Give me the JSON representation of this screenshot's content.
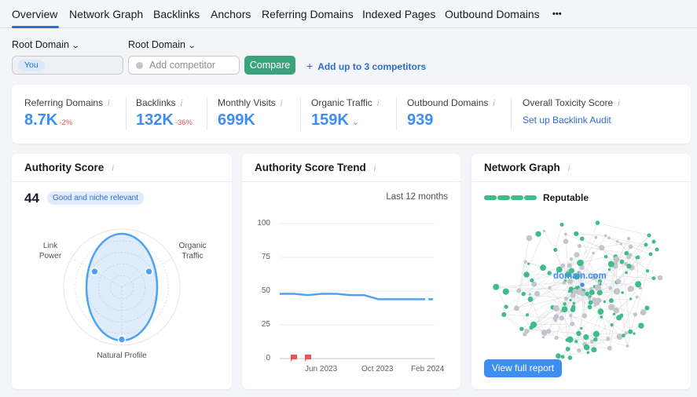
{
  "tabs": [
    {
      "label": "Overview",
      "active": true
    },
    {
      "label": "Network Graph"
    },
    {
      "label": "Backlinks"
    },
    {
      "label": "Anchors"
    },
    {
      "label": "Referring Domains"
    },
    {
      "label": "Indexed Pages"
    },
    {
      "label": "Outbound Domains"
    },
    {
      "label": "•••"
    }
  ],
  "filters": {
    "scope1": "Root Domain",
    "scope2": "Root Domain",
    "you_label": "You",
    "competitor_placeholder": "Add competitor",
    "compare_button": "Compare",
    "add_competitors_link": "Add up to 3 competitors"
  },
  "metrics": [
    {
      "label": "Referring Domains",
      "value": "8.7K",
      "delta": "-2%"
    },
    {
      "label": "Backlinks",
      "value": "132K",
      "delta": "-36%"
    },
    {
      "label": "Monthly Visits",
      "value": "699K"
    },
    {
      "label": "Organic Traffic",
      "value": "159K"
    },
    {
      "label": "Outbound Domains",
      "value": "939"
    },
    {
      "label": "Overall Toxicity Score",
      "link": "Set up Backlink Audit"
    }
  ],
  "authority": {
    "title": "Authority Score",
    "score": "44",
    "badge": "Good and niche relevant",
    "axes": {
      "link_power": "Link\nPower",
      "organic_traffic": "Organic\nTraffic",
      "natural_profile": "Natural Profile"
    },
    "radar_values": {
      "link_power": 0.7,
      "organic_traffic": 0.7,
      "natural_profile": 1.0
    }
  },
  "trend": {
    "title": "Authority Score Trend",
    "period": "Last 12 months",
    "yticks": [
      "100",
      "75",
      "50",
      "25",
      "0"
    ],
    "xticks": [
      "Jun 2023",
      "Oct 2023",
      "Feb 2024"
    ]
  },
  "network": {
    "title": "Network Graph",
    "status": "Reputable",
    "status_level": 4,
    "center_label": "domain.com",
    "button": "View full report"
  },
  "colors": {
    "accent": "#3d8ef0",
    "link": "#2c6ecb",
    "positive": "#3ebc8a",
    "negative": "#e8545a",
    "compare": "#3aa27c"
  },
  "chart_data": [
    {
      "type": "line",
      "title": "Authority Score Trend",
      "xlabel": "",
      "ylabel": "",
      "ylim": [
        0,
        100
      ],
      "yticks": [
        0,
        25,
        50,
        75,
        100
      ],
      "x_tick_labels": [
        "Jun 2023",
        "Oct 2023",
        "Feb 2024"
      ],
      "series": [
        {
          "name": "Authority Score",
          "values": [
            48,
            48,
            47,
            48,
            48,
            47,
            47,
            44,
            44,
            44,
            44,
            44
          ],
          "last_segment_dashed": true
        }
      ],
      "annotations": [
        {
          "type": "flag",
          "color": "red",
          "month_index": 1
        },
        {
          "type": "flag",
          "color": "red",
          "month_index": 2
        }
      ],
      "grid": true
    },
    {
      "type": "radar",
      "title": "Authority Score",
      "axes": [
        "Link Power",
        "Organic Traffic",
        "Natural Profile"
      ],
      "values": [
        0.7,
        0.7,
        1.0
      ]
    }
  ]
}
